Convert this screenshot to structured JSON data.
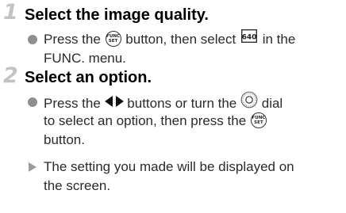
{
  "steps": [
    {
      "number": "1",
      "title": "Select the image quality.",
      "items": [
        {
          "type": "bullet",
          "segments": [
            "Press the",
            "button, then select",
            "in the"
          ],
          "line2": "FUNC. menu."
        }
      ]
    },
    {
      "number": "2",
      "title": "Select an option.",
      "items": [
        {
          "type": "bullet",
          "line1": [
            "Press the",
            "buttons or turn the",
            "dial"
          ],
          "line2": [
            "to select an option, then press the",
            ""
          ],
          "line3": "button."
        },
        {
          "type": "arrow",
          "line1": "The setting you made will be displayed on",
          "line2": "the screen."
        }
      ]
    }
  ],
  "icons": {
    "func_set_top": "FUNC",
    "func_set_bottom": "SET",
    "quality_label": "640"
  }
}
